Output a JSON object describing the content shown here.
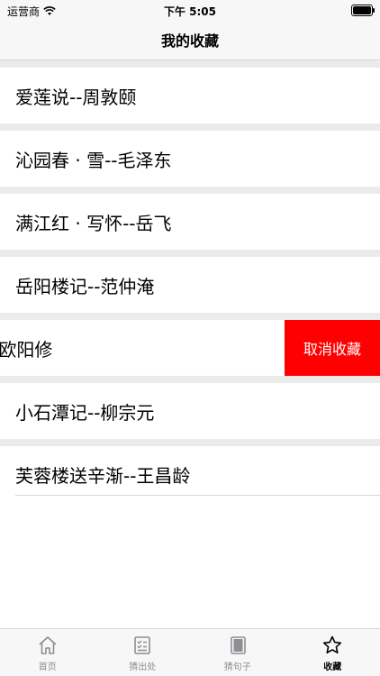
{
  "status": {
    "carrier": "运营商",
    "time": "下午 5:05"
  },
  "nav": {
    "title": "我的收藏"
  },
  "favorites": [
    {
      "label": "爱莲说--周敦颐"
    },
    {
      "label": "沁园春 · 雪--毛泽东"
    },
    {
      "label": "满江红 · 写怀--岳飞"
    },
    {
      "label": "岳阳楼记--范仲淹"
    },
    {
      "label": "--欧阳修"
    },
    {
      "label": "小石潭记--柳宗元"
    },
    {
      "label": "芙蓉楼送辛渐--王昌龄"
    }
  ],
  "swipe_action": {
    "label": "取消收藏",
    "color": "#ff0000"
  },
  "tabs": [
    {
      "label": "首页",
      "icon": "home-icon"
    },
    {
      "label": "猜出处",
      "icon": "checklist-icon"
    },
    {
      "label": "猜句子",
      "icon": "book-icon"
    },
    {
      "label": "收藏",
      "icon": "star-icon"
    }
  ],
  "active_tab": "收藏"
}
